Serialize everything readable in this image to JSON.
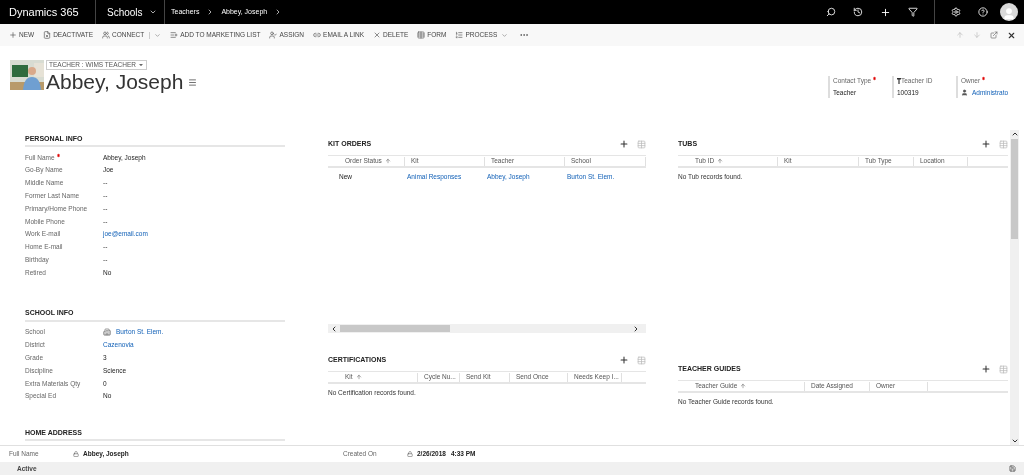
{
  "top_bar": {
    "app_name": "Dynamics 365",
    "area": "Schools",
    "breadcrumb": [
      "Teachers",
      "Abbey, Joseph"
    ]
  },
  "command_bar": {
    "commands": [
      {
        "label": "NEW",
        "dropdown": false,
        "split": false
      },
      {
        "label": "DEACTIVATE",
        "dropdown": false,
        "split": false
      },
      {
        "label": "CONNECT",
        "dropdown": true,
        "split": true
      },
      {
        "label": "ADD TO MARKETING LIST",
        "dropdown": false,
        "split": false
      },
      {
        "label": "ASSIGN",
        "dropdown": false,
        "split": false
      },
      {
        "label": "EMAIL A LINK",
        "dropdown": false,
        "split": false
      },
      {
        "label": "DELETE",
        "dropdown": false,
        "split": false
      },
      {
        "label": "FORM",
        "dropdown": false,
        "split": false
      },
      {
        "label": "PROCESS",
        "dropdown": true,
        "split": false
      }
    ]
  },
  "header": {
    "form_selector": "TEACHER : WIMS TEACHER",
    "record_name": "Abbey, Joseph",
    "fields": [
      {
        "label": "Contact Type",
        "required": true,
        "value": "Teacher",
        "link": false
      },
      {
        "label": "Teacher ID",
        "required": false,
        "value": "100319",
        "link": false
      },
      {
        "label": "Owner",
        "required": true,
        "value": "Administrato",
        "link": true
      }
    ]
  },
  "sections": [
    {
      "title": "PERSONAL INFO",
      "fields": [
        {
          "label": "Full Name",
          "required": true,
          "value": "Abbey, Joseph",
          "link": false
        },
        {
          "label": "Go-By Name",
          "required": false,
          "value": "Joe",
          "link": false
        },
        {
          "label": "Middle Name",
          "required": false,
          "value": "--",
          "link": false
        },
        {
          "label": "Former Last Name",
          "required": false,
          "value": "--",
          "link": false
        },
        {
          "label": "Primary/Home Phone",
          "required": false,
          "value": "--",
          "link": false
        },
        {
          "label": "Mobile Phone",
          "required": false,
          "value": "--",
          "link": false
        },
        {
          "label": "Work E-mail",
          "required": false,
          "value": "joe@email.com",
          "link": true
        },
        {
          "label": "Home E-mail",
          "required": false,
          "value": "--",
          "link": false
        },
        {
          "label": "Birthday",
          "required": false,
          "value": "--",
          "link": false
        },
        {
          "label": "Retired",
          "required": false,
          "value": "No",
          "link": false
        }
      ]
    },
    {
      "title": "SCHOOL INFO",
      "fields": [
        {
          "label": "School",
          "required": false,
          "value": "Burton St. Elem.",
          "link": true,
          "record_icon": true
        },
        {
          "label": "District",
          "required": false,
          "value": "Cazenovia",
          "link": true
        },
        {
          "label": "Grade",
          "required": false,
          "value": "3",
          "link": false
        },
        {
          "label": "Discipline",
          "required": false,
          "value": "Science",
          "link": false
        },
        {
          "label": "Extra Materials Qty",
          "required": false,
          "value": "0",
          "link": false
        },
        {
          "label": "Special Ed",
          "required": false,
          "value": "No",
          "link": false
        }
      ]
    },
    {
      "title": "HOME ADDRESS"
    }
  ],
  "grids": [
    {
      "title": "KIT ORDERS",
      "columns": [
        {
          "label": "Order Status",
          "sorted": true
        },
        {
          "label": "Kit",
          "sorted": false
        },
        {
          "label": "Teacher",
          "sorted": false
        },
        {
          "label": "School",
          "sorted": false
        }
      ],
      "rows": [
        [
          {
            "text": "New",
            "link": false
          },
          {
            "text": "Animal Responses",
            "link": true
          },
          {
            "text": "Abbey, Joseph",
            "link": true
          },
          {
            "text": "Burton St. Elem.",
            "link": true
          }
        ]
      ]
    },
    {
      "title": "TUBS",
      "columns": [
        {
          "label": "Tub ID",
          "sorted": true
        },
        {
          "label": "Kit",
          "sorted": false
        },
        {
          "label": "Tub Type",
          "sorted": false
        },
        {
          "label": "Location",
          "sorted": false
        }
      ],
      "empty": "No Tub records found."
    },
    {
      "title": "CERTIFICATIONS",
      "columns": [
        {
          "label": "Kit",
          "sorted": true
        },
        {
          "label": "Cycle Nu...",
          "sorted": false
        },
        {
          "label": "Send Kit",
          "sorted": false
        },
        {
          "label": "Send Once",
          "sorted": false
        },
        {
          "label": "Needs Keep I...",
          "sorted": false
        }
      ],
      "empty": "No Certification records found."
    },
    {
      "title": "TEACHER GUIDES",
      "columns": [
        {
          "label": "Teacher Guide",
          "sorted": true
        },
        {
          "label": "Date Assigned",
          "sorted": false
        },
        {
          "label": "Owner",
          "sorted": false
        }
      ],
      "empty": "No Teacher Guide records found."
    }
  ],
  "footer": {
    "fields": [
      {
        "label": "Full Name",
        "value": "Abbey, Joseph"
      },
      {
        "label": "Created On",
        "value": "2/26/2018",
        "time": "4:33 PM"
      }
    ]
  },
  "status_bar": {
    "status": "Active"
  }
}
